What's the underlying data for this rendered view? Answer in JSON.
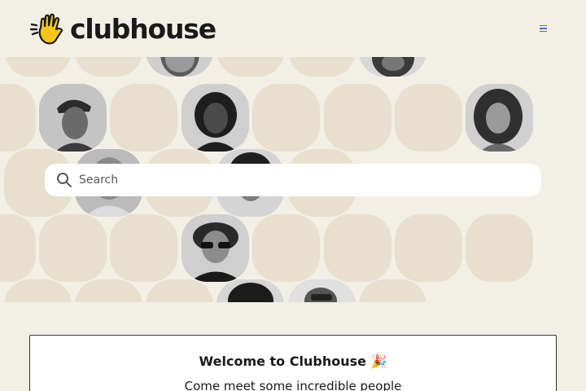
{
  "header": {
    "logo_text": "clubhouse",
    "logo_icon": "waving-hand-icon",
    "menu_icon": "hamburger-menu-icon"
  },
  "search": {
    "placeholder": "Search",
    "value": ""
  },
  "welcome": {
    "title": "Welcome to Clubhouse 🎉",
    "subtitle": "Come meet some incredible people"
  },
  "colors": {
    "background": "#f2efe5",
    "bubble": "#e8dfcf",
    "logo_hand": "#f5c518",
    "accent": "#5b6fb3"
  }
}
